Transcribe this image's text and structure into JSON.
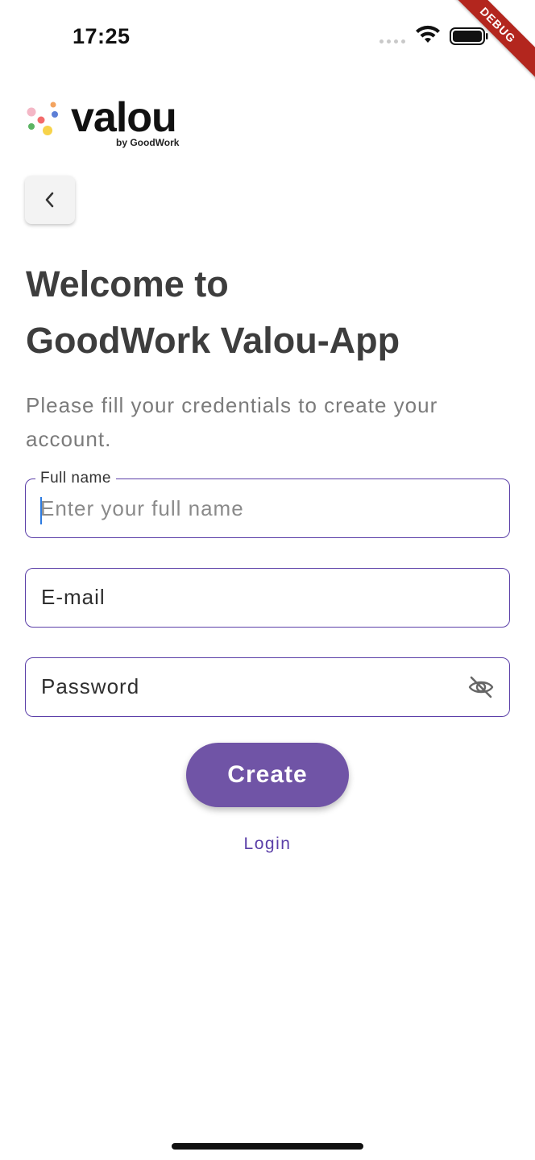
{
  "status_bar": {
    "time": "17:25"
  },
  "debug_label": "DEBUG",
  "logo": {
    "wordmark": "valou",
    "tagline": "by GoodWork"
  },
  "header": {
    "title_line1": "Welcome to",
    "title_line2": "GoodWork Valou-App",
    "subtitle": "Please fill your credentials to create your account."
  },
  "form": {
    "full_name": {
      "label": "Full name",
      "placeholder": "Enter your full name",
      "value": ""
    },
    "email": {
      "placeholder": "E-mail"
    },
    "password": {
      "placeholder": "Password"
    },
    "create_label": "Create",
    "login_label": "Login"
  },
  "colors": {
    "accent": "#5b3fa8",
    "button": "#7054a6",
    "debug": "#b3261e"
  },
  "icons": [
    "back-chevron-icon",
    "wifi-icon",
    "battery-icon",
    "eye-off-icon"
  ]
}
